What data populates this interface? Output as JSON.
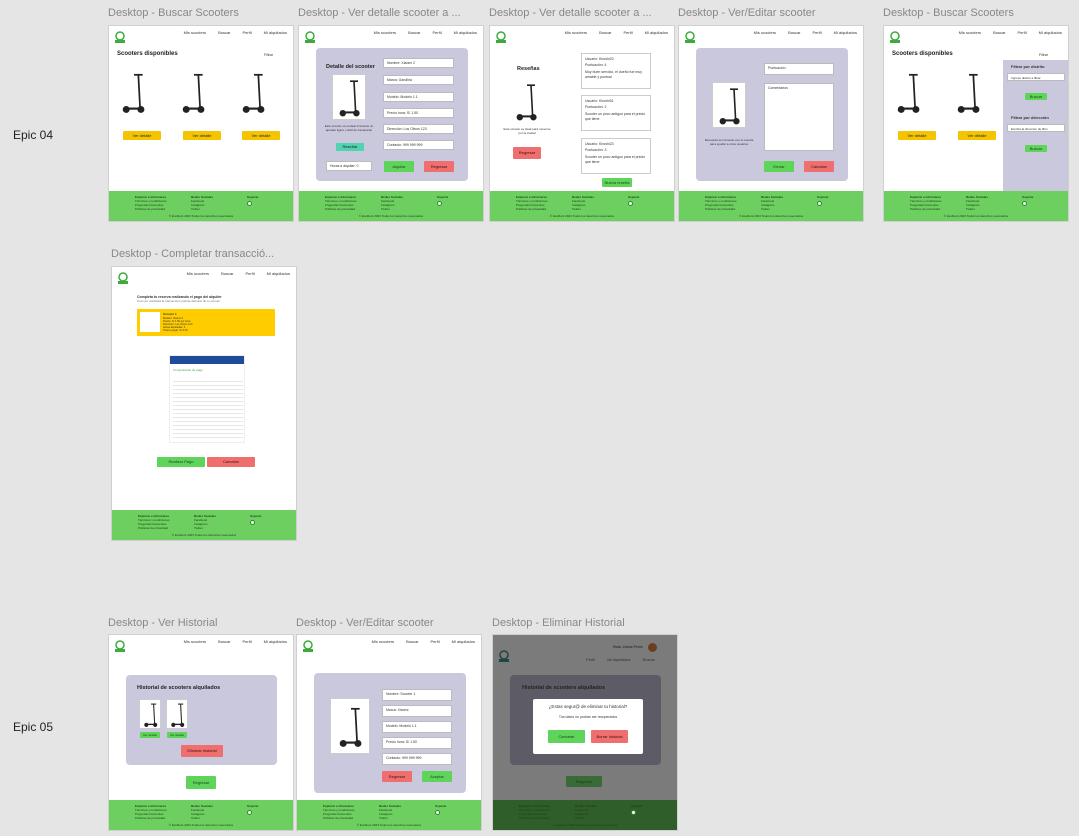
{
  "row_labels": {
    "epic04": "Epic 04",
    "epic05": "Epic 05"
  },
  "nav": {
    "my_scooters": "Mis scooters",
    "search": "Buscar",
    "profile": "Perfil",
    "my_rented": "Mi alquilados"
  },
  "footer": {
    "col1_title": "Explorar e informarse",
    "col1_items": [
      "Términos y condiciones",
      "Preguntas frecuentes",
      "Políticas de privacidad"
    ],
    "col2_title": "Redes Sociales",
    "col2_items": [
      "Facebook",
      "Instagram",
      "Twitter"
    ],
    "col3_title": "Soporte",
    "copy": "© EcoRent 2023 Todos los derechos reservados"
  },
  "frames": {
    "f1": {
      "title": "Desktop - Buscar Scooters",
      "heading": "Scooters disponibles",
      "filter": "Filtrar",
      "button": "Ver detalle"
    },
    "f2": {
      "title": "Desktop - Ver detalle scooter a ...",
      "heading": "Detalle del scooter",
      "fields": [
        "Nombre: Xiaomi 2",
        "Marca: Gandhia",
        "Modelo: Modelo 1.1",
        "Precio hora: S/ 1.50",
        "Dirección: Los Olivos 123",
        "Contacto: 999 999 999"
      ],
      "desc": "Este scooter es el ideal si buscas un aparato ligero y fácil de transportar",
      "rate_btn": "Reseñar",
      "hours": "Horas a alquilar: 0",
      "rent": "Alquilar",
      "back": "Regresar"
    },
    "f3": {
      "title": "Desktop - Ver detalle scooter a ...",
      "heading": "Reseñas",
      "desc": "Este scooter es ideal para moverse por la ciudad",
      "back": "Regresar",
      "more": "Nueva reseña",
      "reviews": [
        {
          "user": "Usuario: Kiroshi23",
          "score": "Puntuación: 4",
          "text": "Muy buen servicio, el dueño fue muy amable y puntual"
        },
        {
          "user": "Usuario: Kiroshi01",
          "score": "Puntuación: 2",
          "text": "Scooter un poco antiguo para el precio que tiene"
        },
        {
          "user": "Usuario: Kiroshi23",
          "score": "Puntuación: 3",
          "text": "Scooter un poco antiguo para el precio que tiene"
        }
      ]
    },
    "f4": {
      "title": "Desktop - Ver/Editar scooter",
      "field1": "Puntuación",
      "field2": "Comentarios",
      "desc": "Recuerda ser honesto con tu reseña para ayudar a otros usuarios",
      "send": "Enviar",
      "cancel": "Cancelar"
    },
    "f5": {
      "title": "Desktop - Buscar Scooters",
      "heading": "Scooters disponibles",
      "filter": "Filtrar",
      "filter_district": "Filtrar por distrito",
      "district_placeholder": "Ingrese distrito a filtrar",
      "filter_address": "Filtrar por dirección",
      "address_placeholder": "Escriba la dirección de filtro",
      "search": "Buscar",
      "button": "Ver detalle"
    },
    "f6": {
      "title": "Desktop - Completar transacció...",
      "heading": "Completa tu reserva realizando el pago del alquiler",
      "sub": "Una vez realizada la transacción podrás disfrutar de tu scooter",
      "scooter": "Scooter 1",
      "details": [
        "Modelo: Xiaomi 2",
        "Precio: S/ 1.50 por hora",
        "Dirección: Los Olivos 123",
        "Horas alquiladas: 4",
        "Total a pagar: S/ 6.00"
      ],
      "receipt": "Comprobante de pago",
      "pay": "Realizar Pago",
      "cancel": "Cancelar"
    },
    "f7": {
      "title": "Desktop - Ver Historial",
      "heading": "Historial de scooters alquilados",
      "detail": "Ver detalle",
      "delete": "Eliminar historial",
      "back": "Regresar"
    },
    "f8": {
      "title": "Desktop - Ver/Editar scooter",
      "fields": [
        "Nombre: Scooter 1",
        "Marca: Xiaomi",
        "Modelo: Modelo 1.1",
        "Precio hora: S/ 1.50",
        "Contacto: 999 999 999"
      ],
      "back": "Regresar",
      "rent": "Aceptar"
    },
    "f9": {
      "title": "Desktop - Eliminar Historial",
      "user": "Hola, Jesús Pérez",
      "heading": "Historial de scooters alquilados",
      "modal_title": "¿Estas segur@ de eliminar tu historial?",
      "modal_text": "Tus datos no podrán ser recuperados",
      "cancel": "Cancelar",
      "confirm": "Borrar historial",
      "back": "Regresar"
    }
  }
}
